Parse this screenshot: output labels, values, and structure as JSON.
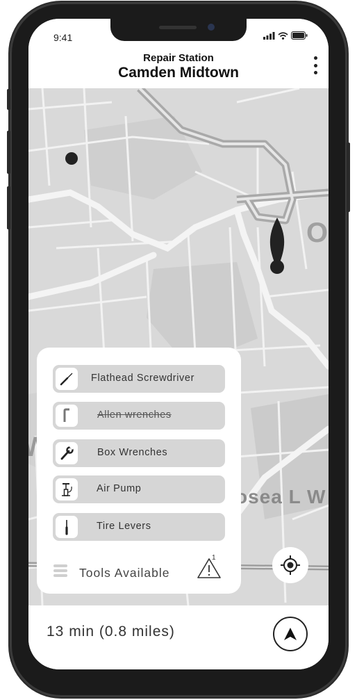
{
  "status_bar": {
    "time": "9:41"
  },
  "header": {
    "subtitle": "Repair Station",
    "title": "Camden Midtown"
  },
  "map": {
    "labels": {
      "street_fragment": "osea L W",
      "place_fragment": "O",
      "edge_letter": "W"
    }
  },
  "tools_panel": {
    "tools": [
      {
        "label": "Flathead Screwdriver",
        "icon": "screwdriver-icon",
        "available": true
      },
      {
        "label": "Allen wrenches",
        "icon": "allen-wrench-icon",
        "available": false
      },
      {
        "label": "Box Wrenches",
        "icon": "wrench-icon",
        "available": true
      },
      {
        "label": "Air Pump",
        "icon": "air-pump-icon",
        "available": true
      },
      {
        "label": "Tire Levers",
        "icon": "tire-lever-icon",
        "available": true
      }
    ],
    "footer_label": "Tools Available",
    "warning_count": "1"
  },
  "bottom_bar": {
    "eta": "13 min (0.8 miles)"
  },
  "colors": {
    "map_background": "#d9d9d9",
    "road": "#f2f2f2",
    "tool_pill": "#d6d6d6",
    "marker": "#222222"
  }
}
